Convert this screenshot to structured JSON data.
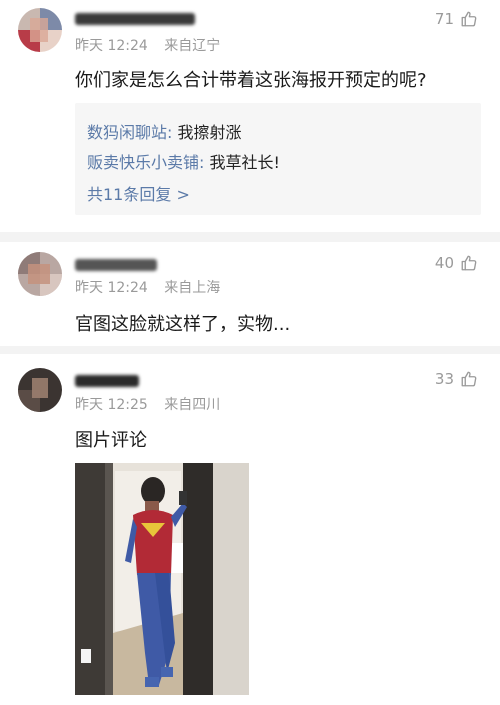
{
  "comments": [
    {
      "time": "昨天 12:24",
      "location": "来自辽宁",
      "likes": "71",
      "text": "你们家是怎么合计带着这张海报开预定的呢?",
      "replies": [
        {
          "name": "数犸闲聊站",
          "sep": ": ",
          "text": "我擦射涨"
        },
        {
          "name": "贩卖快乐小卖铺",
          "sep": ": ",
          "text": "我草社长!"
        }
      ],
      "more_label": "共11条回复 >"
    },
    {
      "time": "昨天 12:24",
      "location": "来自上海",
      "likes": "40",
      "text": "官图这脸就这样了，实物..."
    },
    {
      "time": "昨天 12:25",
      "location": "来自四川",
      "likes": "33",
      "text": "图片评论"
    }
  ],
  "colors": {
    "link": "#5b7aa8",
    "meta": "#9a9a9a",
    "reply_bg": "#f6f6f6",
    "divider": "#f3f3f3"
  },
  "icons": [
    "thumbs-up-icon"
  ]
}
